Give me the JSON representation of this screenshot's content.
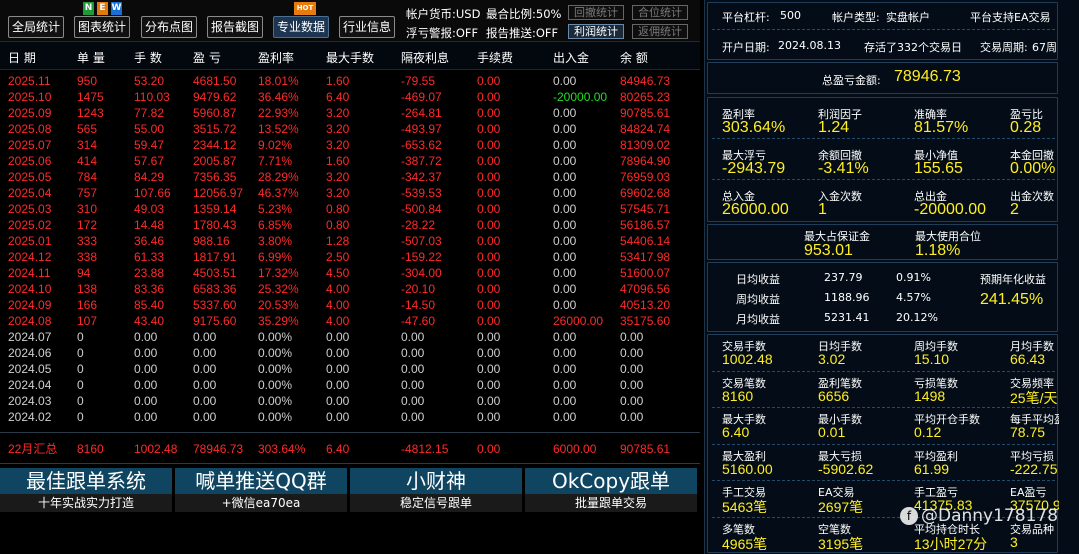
{
  "toolbar": {
    "buttons": [
      "全局统计",
      "图表统计",
      "分布点图",
      "报告截图",
      "专业数据",
      "行业信息"
    ],
    "flag_new": [
      "N",
      "E",
      "W"
    ],
    "flag_hot": "HOT",
    "info": {
      "currency": "帐户货币:USD",
      "leverage_ratio": "最合比例:50%",
      "float_alert": "浮亏警报:OFF",
      "report_push": "报告推送:OFF"
    },
    "side_buttons": [
      "回撤统计",
      "合位统计",
      "利润统计",
      "返佣统计"
    ]
  },
  "table": {
    "headers": [
      "日 期",
      "单 量",
      "手 数",
      "盈 亏",
      "盈利率",
      "最大手数",
      "隔夜利息",
      "手续费",
      "出入金",
      "余 额"
    ],
    "rows": [
      [
        "2025.11",
        "950",
        "53.20",
        "4681.50",
        "18.01%",
        "1.60",
        "-79.55",
        "0.00",
        "0.00",
        "84946.73"
      ],
      [
        "2025.10",
        "1475",
        "110.03",
        "9479.62",
        "36.46%",
        "6.40",
        "-469.07",
        "0.00",
        "-20000.00",
        "80265.23"
      ],
      [
        "2025.09",
        "1243",
        "77.82",
        "5960.87",
        "22.93%",
        "3.20",
        "-264.81",
        "0.00",
        "0.00",
        "90785.61"
      ],
      [
        "2025.08",
        "565",
        "55.00",
        "3515.72",
        "13.52%",
        "3.20",
        "-493.97",
        "0.00",
        "0.00",
        "84824.74"
      ],
      [
        "2025.07",
        "314",
        "59.47",
        "2344.12",
        "9.02%",
        "3.20",
        "-653.62",
        "0.00",
        "0.00",
        "81309.02"
      ],
      [
        "2025.06",
        "414",
        "57.67",
        "2005.87",
        "7.71%",
        "1.60",
        "-387.72",
        "0.00",
        "0.00",
        "78964.90"
      ],
      [
        "2025.05",
        "784",
        "84.29",
        "7356.35",
        "28.29%",
        "3.20",
        "-342.37",
        "0.00",
        "0.00",
        "76959.03"
      ],
      [
        "2025.04",
        "757",
        "107.66",
        "12056.97",
        "46.37%",
        "3.20",
        "-539.53",
        "0.00",
        "0.00",
        "69602.68"
      ],
      [
        "2025.03",
        "310",
        "49.03",
        "1359.14",
        "5.23%",
        "0.80",
        "-500.84",
        "0.00",
        "0.00",
        "57545.71"
      ],
      [
        "2025.02",
        "172",
        "14.48",
        "1780.43",
        "6.85%",
        "0.80",
        "-28.22",
        "0.00",
        "0.00",
        "56186.57"
      ],
      [
        "2025.01",
        "333",
        "36.46",
        "988.16",
        "3.80%",
        "1.28",
        "-507.03",
        "0.00",
        "0.00",
        "54406.14"
      ],
      [
        "2024.12",
        "338",
        "61.33",
        "1817.91",
        "6.99%",
        "2.50",
        "-159.22",
        "0.00",
        "0.00",
        "53417.98"
      ],
      [
        "2024.11",
        "94",
        "23.88",
        "4503.51",
        "17.32%",
        "4.50",
        "-304.00",
        "0.00",
        "0.00",
        "51600.07"
      ],
      [
        "2024.10",
        "138",
        "83.36",
        "6583.36",
        "25.32%",
        "4.00",
        "-20.10",
        "0.00",
        "0.00",
        "47096.56"
      ],
      [
        "2024.09",
        "166",
        "85.40",
        "5337.60",
        "20.53%",
        "4.00",
        "-14.50",
        "0.00",
        "0.00",
        "40513.20"
      ],
      [
        "2024.08",
        "107",
        "43.40",
        "9175.60",
        "35.29%",
        "4.00",
        "-47.60",
        "0.00",
        "26000.00",
        "35175.60"
      ],
      [
        "2024.07",
        "0",
        "0.00",
        "0.00",
        "0.00%",
        "0.00",
        "0.00",
        "0.00",
        "0.00",
        "0.00"
      ],
      [
        "2024.06",
        "0",
        "0.00",
        "0.00",
        "0.00%",
        "0.00",
        "0.00",
        "0.00",
        "0.00",
        "0.00"
      ],
      [
        "2024.05",
        "0",
        "0.00",
        "0.00",
        "0.00%",
        "0.00",
        "0.00",
        "0.00",
        "0.00",
        "0.00"
      ],
      [
        "2024.04",
        "0",
        "0.00",
        "0.00",
        "0.00%",
        "0.00",
        "0.00",
        "0.00",
        "0.00",
        "0.00"
      ],
      [
        "2024.03",
        "0",
        "0.00",
        "0.00",
        "0.00%",
        "0.00",
        "0.00",
        "0.00",
        "0.00",
        "0.00"
      ],
      [
        "2024.02",
        "0",
        "0.00",
        "0.00",
        "0.00%",
        "0.00",
        "0.00",
        "0.00",
        "0.00",
        "0.00"
      ]
    ],
    "active_row_count": 16,
    "summary": [
      "22月汇总",
      "8160",
      "1002.48",
      "78946.73",
      "303.64%",
      "6.40",
      "-4812.15",
      "0.00",
      "6000.00",
      "90785.61"
    ]
  },
  "banners": [
    {
      "title": "最佳跟单系统",
      "subtitle": "十年实战实力打造"
    },
    {
      "title": "喊单推送QQ群",
      "subtitle": "+微信ea70ea"
    },
    {
      "title": "小财神",
      "subtitle": "稳定信号跟单"
    },
    {
      "title": "OkCopy跟单",
      "subtitle": "批量跟单交易"
    }
  ],
  "right": {
    "header1": [
      "平台杠杆:",
      "500",
      "帐户类型:",
      "实盘帐户",
      "平台支持EA交易"
    ],
    "header2": [
      "开户日期:",
      "2024.08.13",
      "存活了332个交易日",
      "交易周期:",
      "67周"
    ],
    "total_label": "总盈亏金额:",
    "total_value": "78946.73",
    "stats1": [
      {
        "label": "盈利率",
        "value": "303.64%"
      },
      {
        "label": "利润因子",
        "value": "1.24"
      },
      {
        "label": "准确率",
        "value": "81.57%"
      },
      {
        "label": "盈亏比",
        "value": "0.28"
      },
      {
        "label": "最大浮亏",
        "value": "-2943.79"
      },
      {
        "label": "余额回撤",
        "value": "-3.41%"
      },
      {
        "label": "最小净值",
        "value": "155.65"
      },
      {
        "label": "本金回撤",
        "value": "0.00%"
      },
      {
        "label": "总入金",
        "value": "26000.00"
      },
      {
        "label": "入金次数",
        "value": "1"
      },
      {
        "label": "总出金",
        "value": "-20000.00"
      },
      {
        "label": "出金次数",
        "value": "2"
      }
    ],
    "margin": [
      {
        "label": "最大占保证金",
        "value": "953.01"
      },
      {
        "label": "最大使用合位",
        "value": "1.18%"
      }
    ],
    "returns": [
      [
        "日均收益",
        "237.79",
        "0.91%"
      ],
      [
        "周均收益",
        "1188.96",
        "4.57%"
      ],
      [
        "月均收益",
        "5231.41",
        "20.12%"
      ]
    ],
    "annual_label": "预期年化收益",
    "annual_value": "241.45%",
    "stats2": [
      {
        "label": "交易手数",
        "value": "1002.48"
      },
      {
        "label": "日均手数",
        "value": "3.02"
      },
      {
        "label": "周均手数",
        "value": "15.10"
      },
      {
        "label": "月均手数",
        "value": "66.43"
      },
      {
        "label": "交易笔数",
        "value": "8160"
      },
      {
        "label": "盈利笔数",
        "value": "6656"
      },
      {
        "label": "亏损笔数",
        "value": "1498"
      },
      {
        "label": "交易频率",
        "value": "25笔/天"
      },
      {
        "label": "最大手数",
        "value": "6.40"
      },
      {
        "label": "最小手数",
        "value": "0.01"
      },
      {
        "label": "平均开仓手数",
        "value": "0.12"
      },
      {
        "label": "每手平均盈亏",
        "value": "78.75"
      },
      {
        "label": "最大盈利",
        "value": "5160.00"
      },
      {
        "label": "最大亏损",
        "value": "-5902.62"
      },
      {
        "label": "平均盈利",
        "value": "61.99"
      },
      {
        "label": "平均亏损",
        "value": "-222.75"
      },
      {
        "label": "手工交易",
        "value": "5463笔"
      },
      {
        "label": "EA交易",
        "value": "2697笔"
      },
      {
        "label": "手工盈亏",
        "value": "41375.83"
      },
      {
        "label": "EA盈亏",
        "value": "37570.90"
      },
      {
        "label": "多笔数",
        "value": "4965笔"
      },
      {
        "label": "空笔数",
        "value": "3195笔"
      },
      {
        "label": "平均持仓时长",
        "value": "13小时27分"
      },
      {
        "label": "交易品种",
        "value": "3"
      }
    ]
  },
  "watermark": "@Danny178178",
  "watermark_logo": "f",
  "colors": {
    "red": "#ff2a2a",
    "green": "#22dd22",
    "gray": "#cfcfcf",
    "yellow": "#ffee22",
    "banner_blue": "#0f4560"
  }
}
